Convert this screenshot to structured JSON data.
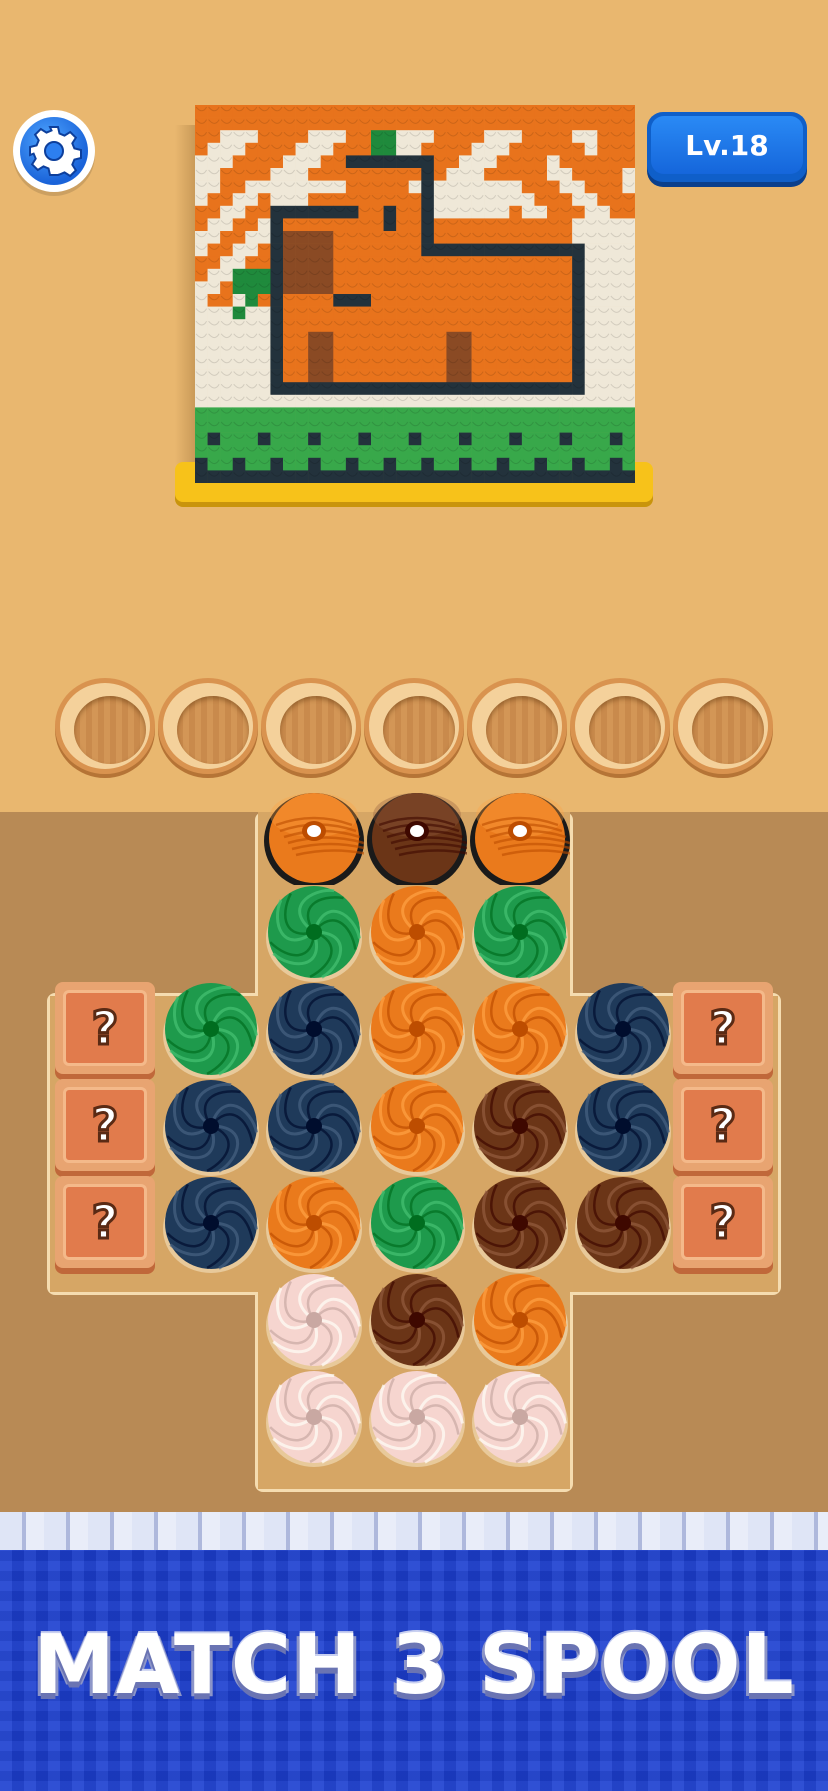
{
  "header": {
    "settings_icon": "gear-icon",
    "level_label": "Lv.18"
  },
  "artwork": {
    "subject": "capybara knit picture",
    "colors": {
      "cream": "#efe8d8",
      "orange": "#e8731c",
      "outline": "#23323c",
      "brown": "#8a4a24",
      "leaf": "#1f8a3c",
      "grass": "#38a84a",
      "stand": "#f7c21a"
    }
  },
  "slots": {
    "count": 7
  },
  "spool_colors": {
    "orange": "#ea7a1c",
    "brown": "#6b3517",
    "green": "#1e9a4c",
    "navy": "#1f3a5a",
    "pink": "#f6d5cf"
  },
  "spools": [
    {
      "col": 2,
      "row": 0,
      "color": "orange",
      "top": true
    },
    {
      "col": 3,
      "row": 0,
      "color": "brown",
      "top": true
    },
    {
      "col": 4,
      "row": 0,
      "color": "orange",
      "top": true
    },
    {
      "col": 2,
      "row": 1,
      "color": "green"
    },
    {
      "col": 3,
      "row": 1,
      "color": "orange"
    },
    {
      "col": 4,
      "row": 1,
      "color": "green"
    },
    {
      "col": 1,
      "row": 2,
      "color": "green"
    },
    {
      "col": 2,
      "row": 2,
      "color": "navy"
    },
    {
      "col": 3,
      "row": 2,
      "color": "orange"
    },
    {
      "col": 4,
      "row": 2,
      "color": "orange"
    },
    {
      "col": 5,
      "row": 2,
      "color": "navy"
    },
    {
      "col": 1,
      "row": 3,
      "color": "navy"
    },
    {
      "col": 2,
      "row": 3,
      "color": "navy"
    },
    {
      "col": 3,
      "row": 3,
      "color": "orange"
    },
    {
      "col": 4,
      "row": 3,
      "color": "brown"
    },
    {
      "col": 5,
      "row": 3,
      "color": "navy"
    },
    {
      "col": 1,
      "row": 4,
      "color": "navy"
    },
    {
      "col": 2,
      "row": 4,
      "color": "orange"
    },
    {
      "col": 3,
      "row": 4,
      "color": "green"
    },
    {
      "col": 4,
      "row": 4,
      "color": "brown"
    },
    {
      "col": 5,
      "row": 4,
      "color": "brown"
    },
    {
      "col": 2,
      "row": 5,
      "color": "pink"
    },
    {
      "col": 3,
      "row": 5,
      "color": "brown"
    },
    {
      "col": 4,
      "row": 5,
      "color": "orange"
    },
    {
      "col": 2,
      "row": 6,
      "color": "pink"
    },
    {
      "col": 3,
      "row": 6,
      "color": "pink"
    },
    {
      "col": 4,
      "row": 6,
      "color": "pink"
    }
  ],
  "mystery_boxes": {
    "label": "?",
    "left": [
      2,
      3,
      4
    ],
    "right": [
      2,
      3,
      4
    ]
  },
  "footer": {
    "title": "MATCH 3 SPOOL"
  }
}
